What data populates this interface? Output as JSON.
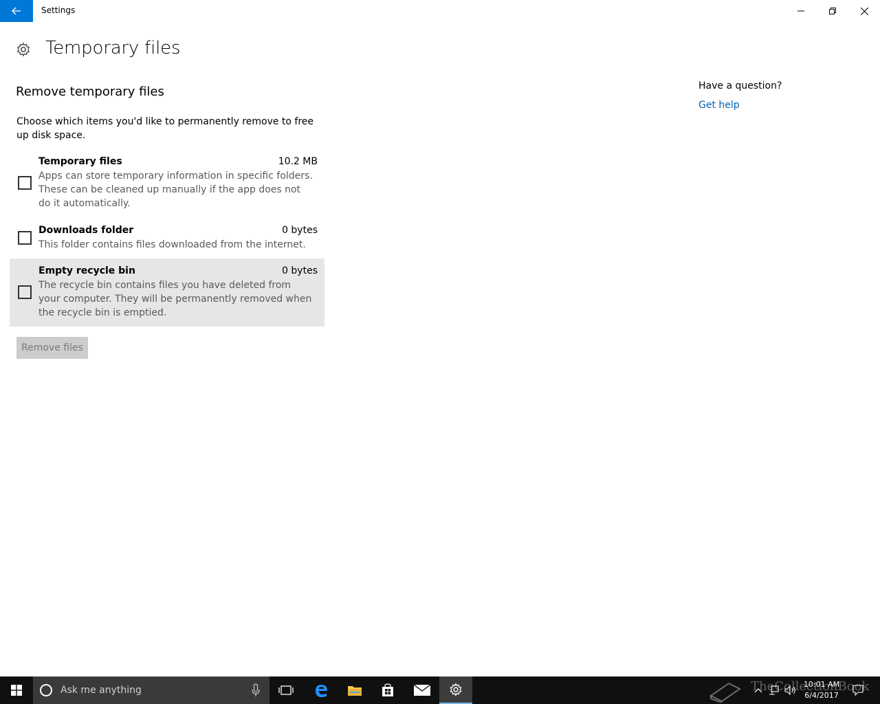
{
  "window": {
    "title": "Settings"
  },
  "page": {
    "title": "Temporary files",
    "section_title": "Remove temporary files",
    "intro": "Choose which items you'd like to permanently remove to free up disk space."
  },
  "items": [
    {
      "name": "Temporary files",
      "size": "10.2 MB",
      "description": "Apps can store temporary information in specific folders. These can be cleaned up manually if the app does not do it automatically.",
      "checked": false
    },
    {
      "name": "Downloads folder",
      "size": "0 bytes",
      "description": "This folder contains files downloaded from the internet.",
      "checked": false
    },
    {
      "name": "Empty recycle bin",
      "size": "0 bytes",
      "description": "The recycle bin contains files you have deleted from your computer. They will be permanently removed when the recycle bin is emptied.",
      "checked": false
    }
  ],
  "actions": {
    "remove_label": "Remove files"
  },
  "help": {
    "question": "Have a question?",
    "link": "Get help"
  },
  "taskbar": {
    "search_placeholder": "Ask me anything",
    "time": "10:01 AM",
    "date": "6/4/2017",
    "watermark": "TheCollectionBook"
  },
  "colors": {
    "accent": "#0078d7",
    "link": "#0063b1",
    "hover_row": "#e6e6e6",
    "button_disabled": "#cccccc"
  }
}
